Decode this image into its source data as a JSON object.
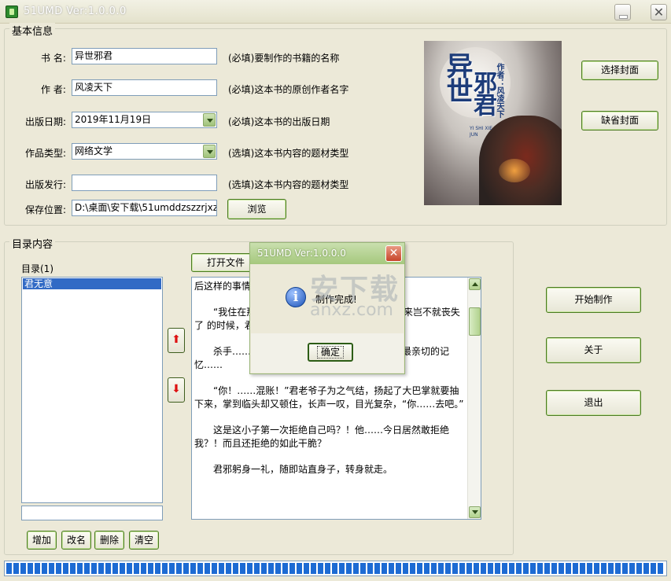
{
  "window": {
    "title": "51UMD Ver:1.0.0.0",
    "close_glyph": "✕"
  },
  "basic_info": {
    "group_title": "基本信息",
    "book_name": {
      "label": "书  名:",
      "value": "异世邪君",
      "hint": "(必填)要制作的书籍的名称"
    },
    "author": {
      "label": "作  者:",
      "value": "风凌天下",
      "hint": "(必填)这本书的原创作者名字"
    },
    "publish_date": {
      "label": "出版日期:",
      "value": "2019年11月19日",
      "hint": "(必填)这本书的出版日期"
    },
    "genre": {
      "label": "作品类型:",
      "value": "网络文学",
      "hint": "(选填)这本书内容的题材类型"
    },
    "publisher": {
      "label": "出版发行:",
      "value": "",
      "hint": "(选填)这本书内容的题材类型"
    },
    "save_path": {
      "label": "保存位置:",
      "value": "D:\\桌面\\安下载\\51umddzszzrjxz\\",
      "browse_label": "浏览"
    },
    "choose_cover_label": "选择封面",
    "default_cover_label": "缺省封面",
    "cover": {
      "title_a": "异世",
      "title_b": "邪君",
      "author": "作者：风凌天下",
      "pinyin": "YI SHI XIE JUN"
    }
  },
  "toc": {
    "group_title": "目录内容",
    "list_label": "目录(1)",
    "items": [
      "君无意"
    ],
    "name_input": "",
    "open_file_label": "打开文件",
    "up_glyph": "⬆",
    "down_glyph": "⬇",
    "add_label": "增加",
    "rename_label": "改名",
    "delete_label": "删除",
    "clear_label": "清空",
    "content": [
      "后这样的事情",
      "“我住在那                           拒绝，开玩笑，正要见识                    若是搬回来岂不就丧失了                    的时候，君邪心中就有些隐",
      "杀手……那已经是很遥远的事情了，可那却也最亲切的记忆……",
      "“你！……混账！”君老爷子为之气结，扬起了大巴掌就要抽下来，掌到临头却又顿住，长声一叹，目光复杂，“你……去吧。”",
      "这是这小子第一次拒绝自己吗？！他……今日居然敢拒绝我？！而且还拒绝的如此干脆？",
      "君邪躬身一礼，随即站直身子，转身就走。"
    ]
  },
  "actions": {
    "start_label": "开始制作",
    "about_label": "关于",
    "exit_label": "退出"
  },
  "dialog": {
    "title": "51UMD Ver:1.0.0.0",
    "close_glyph": "✕",
    "info_glyph": "i",
    "message": "制作完成!",
    "ok_label": "确定"
  },
  "watermark": {
    "text": "安下载",
    "url": "anxz.com"
  },
  "progress": {
    "percent": 100
  },
  "colors": {
    "accent": "#316ac5",
    "progress": "#1d6bd3",
    "arrow": "#d11111"
  }
}
